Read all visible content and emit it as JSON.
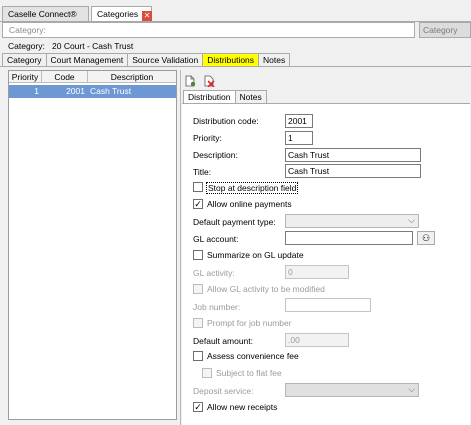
{
  "window_tabs": [
    {
      "label": "Caselle Connect®"
    },
    {
      "label": "Categories"
    }
  ],
  "search": {
    "placeholder": "Category:",
    "button_label": "Category"
  },
  "category_line": {
    "label": "Category:",
    "value": "20  Court - Cash Trust"
  },
  "sub_tabs": [
    {
      "label": "Category"
    },
    {
      "label": "Court Management"
    },
    {
      "label": "Source Validation"
    },
    {
      "label": "Distributions",
      "active": true
    },
    {
      "label": "Notes"
    }
  ],
  "table": {
    "columns": [
      "Priority",
      "Code",
      "Description"
    ],
    "rows": [
      {
        "priority": "1",
        "code": "2001",
        "description": "Cash Trust"
      }
    ]
  },
  "toolbar": {
    "icons": [
      "new-document-icon",
      "delete-icon"
    ]
  },
  "inner_tabs": [
    {
      "label": "Distribution",
      "active": true
    },
    {
      "label": "Notes"
    }
  ],
  "form": {
    "distribution_code": {
      "label": "Distribution code:",
      "value": "2001"
    },
    "priority": {
      "label": "Priority:",
      "value": "1"
    },
    "description": {
      "label": "Description:",
      "value": "Cash Trust"
    },
    "title": {
      "label": "Title:",
      "value": "Cash Trust"
    },
    "stop_at_description": {
      "label": "Stop at description field",
      "checked": false
    },
    "allow_online_payments": {
      "label": "Allow online payments",
      "checked": true
    },
    "default_payment_type": {
      "label": "Default payment type:",
      "value": ""
    },
    "gl_account": {
      "label": "GL account:",
      "value": ""
    },
    "summarize_on_gl": {
      "label": "Summarize on GL update",
      "checked": false
    },
    "gl_activity": {
      "label": "GL activity:",
      "value": "0"
    },
    "allow_gl_modify": {
      "label": "Allow GL activity to be modified",
      "checked": false
    },
    "job_number": {
      "label": "Job number:",
      "value": ""
    },
    "prompt_job_number": {
      "label": "Prompt for job number",
      "checked": false
    },
    "default_amount": {
      "label": "Default amount:",
      "value": ".00"
    },
    "assess_convenience_fee": {
      "label": "Assess convenience fee",
      "checked": false
    },
    "subject_to_flat_fee": {
      "label": "Subject to flat fee",
      "checked": false
    },
    "deposit_service": {
      "label": "Deposit service:",
      "value": ""
    },
    "allow_new_receipts": {
      "label": "Allow new receipts",
      "checked": true
    }
  },
  "colors": {
    "active_subtab": "#ffff00",
    "selected_row": "#6d98d4",
    "close_icon": "#e04a3a"
  }
}
